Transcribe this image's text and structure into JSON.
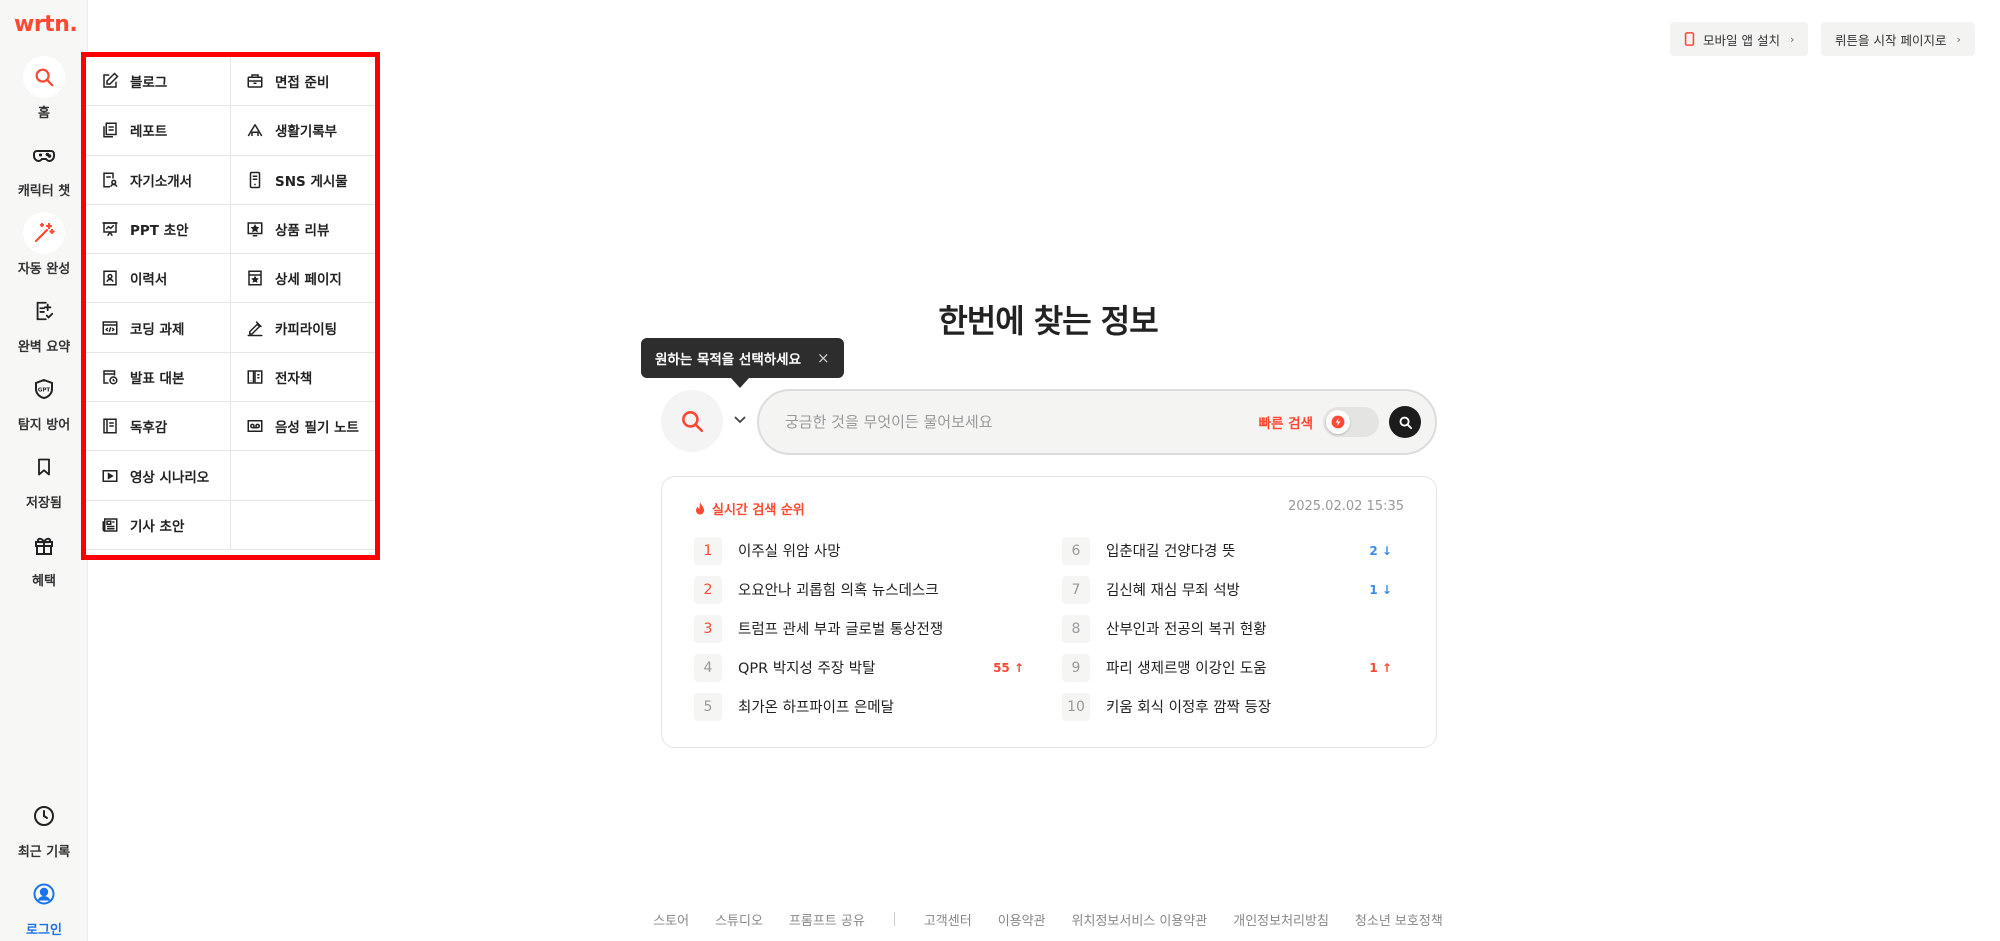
{
  "app": {
    "logo": "wrtn.",
    "brand_color": "#ff4932"
  },
  "sidebar": {
    "items": [
      {
        "label": "홈",
        "icon": "search-icon"
      },
      {
        "label": "캐릭터 챗",
        "icon": "gamepad-icon"
      },
      {
        "label": "자동 완성",
        "icon": "magic-wand-icon"
      },
      {
        "label": "완벽 요약",
        "icon": "summary-doc-icon"
      },
      {
        "label": "탐지 방어",
        "icon": "gpt-shield-icon"
      },
      {
        "label": "저장됨",
        "icon": "bookmark-icon"
      },
      {
        "label": "혜택",
        "icon": "gift-icon"
      }
    ],
    "bottom_items": [
      {
        "label": "최근 기록",
        "icon": "clock-icon"
      },
      {
        "label": "로그인",
        "icon": "user-icon"
      }
    ]
  },
  "purpose_menu": {
    "items": [
      {
        "label": "블로그",
        "icon": "pencil-square-icon"
      },
      {
        "label": "면접 준비",
        "icon": "briefcase-icon"
      },
      {
        "label": "레포트",
        "icon": "copy-doc-icon"
      },
      {
        "label": "생활기록부",
        "icon": "house-icon"
      },
      {
        "label": "자기소개서",
        "icon": "doc-person-icon"
      },
      {
        "label": "SNS 게시물",
        "icon": "phone-icon"
      },
      {
        "label": "PPT 초안",
        "icon": "presentation-icon"
      },
      {
        "label": "상품 리뷰",
        "icon": "star-review-icon"
      },
      {
        "label": "이력서",
        "icon": "resume-icon"
      },
      {
        "label": "상세 페이지",
        "icon": "detail-page-icon"
      },
      {
        "label": "코딩 과제",
        "icon": "code-icon"
      },
      {
        "label": "카피라이팅",
        "icon": "pen-nib-icon"
      },
      {
        "label": "발표 대본",
        "icon": "script-clock-icon"
      },
      {
        "label": "전자책",
        "icon": "ebook-icon"
      },
      {
        "label": "독후감",
        "icon": "book-report-icon"
      },
      {
        "label": "음성 필기 노트",
        "icon": "voicemail-icon"
      },
      {
        "label": "영상 시나리오",
        "icon": "video-icon"
      },
      {
        "label": "기사 초안",
        "icon": "newspaper-icon"
      }
    ]
  },
  "top_buttons": {
    "mobile_app": "모바일 앱 설치",
    "start_page": "뤼튼을 시작 페이지로"
  },
  "hero": {
    "title": "한번에 찾는 정보"
  },
  "tooltip": {
    "text": "원하는 목적을 선택하세요",
    "close": "×"
  },
  "search": {
    "placeholder": "궁금한 것을 무엇이든 물어보세요",
    "quick_label": "빠른 검색"
  },
  "trending": {
    "title": "실시간 검색 순위",
    "timestamp": "2025.02.02 15:35",
    "left": [
      {
        "rank": "1",
        "term": "이주실 위암 사망",
        "delta": ""
      },
      {
        "rank": "2",
        "term": "오요안나 괴롭힘 의혹 뉴스데스크",
        "delta": ""
      },
      {
        "rank": "3",
        "term": "트럼프 관세 부과 글로벌 통상전쟁",
        "delta": ""
      },
      {
        "rank": "4",
        "term": "QPR 박지성 주장 박탈",
        "delta": "55 ↑",
        "dir": "up"
      },
      {
        "rank": "5",
        "term": "최가온 하프파이프 은메달",
        "delta": ""
      }
    ],
    "right": [
      {
        "rank": "6",
        "term": "입춘대길 건양다경 뜻",
        "delta": "2 ↓",
        "dir": "down"
      },
      {
        "rank": "7",
        "term": "김신혜 재심 무죄 석방",
        "delta": "1 ↓",
        "dir": "down"
      },
      {
        "rank": "8",
        "term": "산부인과 전공의 복귀 현황",
        "delta": ""
      },
      {
        "rank": "9",
        "term": "파리 생제르맹 이강인 도움",
        "delta": "1 ↑",
        "dir": "up"
      },
      {
        "rank": "10",
        "term": "키움 회식 이정후 깜짝 등장",
        "delta": ""
      }
    ]
  },
  "footer": {
    "group1": [
      "스토어",
      "스튜디오",
      "프롬프트 공유"
    ],
    "group2": [
      "고객센터",
      "이용약관",
      "위치정보서비스 이용약관",
      "개인정보처리방침",
      "청소년 보호정책"
    ]
  }
}
